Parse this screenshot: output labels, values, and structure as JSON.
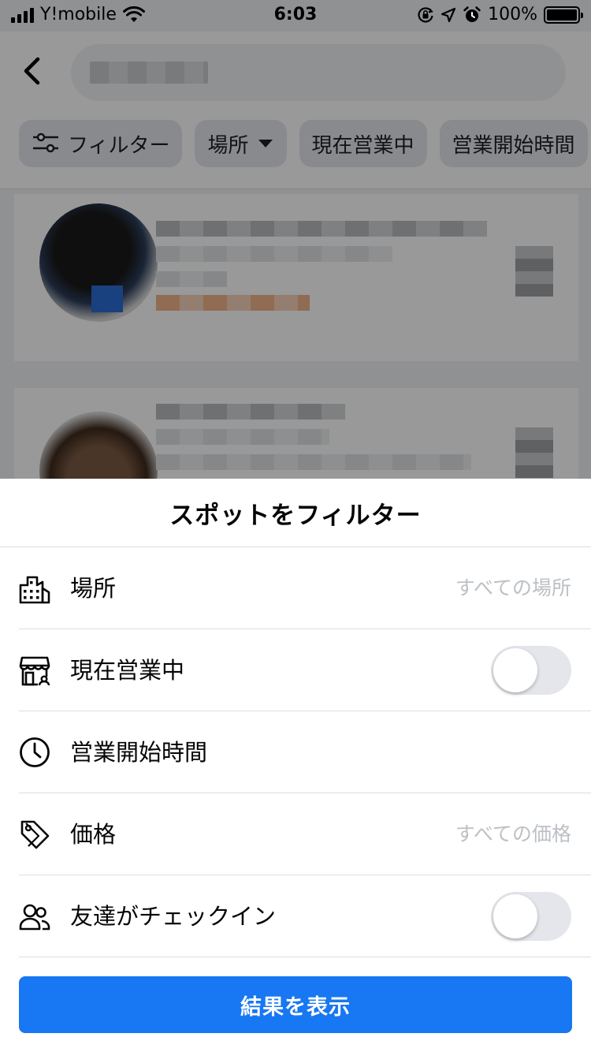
{
  "status_bar": {
    "carrier": "Y!mobile",
    "time": "6:03",
    "battery": "100%",
    "icons": [
      "signal-icon",
      "wifi-icon",
      "orientation-lock-icon",
      "location-icon",
      "alarm-icon",
      "battery-icon"
    ]
  },
  "background": {
    "filter_chips": [
      {
        "label": "フィルター",
        "icon": "sliders-icon"
      },
      {
        "label": "場所",
        "icon": "caret-down-icon"
      },
      {
        "label": "現在営業中"
      },
      {
        "label": "営業開始時間"
      }
    ]
  },
  "sheet": {
    "title": "スポットをフィルター",
    "rows": [
      {
        "label": "場所",
        "value": "すべての場所",
        "icon": "building-icon"
      },
      {
        "label": "現在営業中",
        "toggle_on": false,
        "icon": "storefront-icon"
      },
      {
        "label": "営業開始時間",
        "icon": "clock-icon"
      },
      {
        "label": "価格",
        "value": "すべての価格",
        "icon": "price-tag-icon"
      },
      {
        "label": "友達がチェックイン",
        "toggle_on": false,
        "icon": "friends-icon"
      }
    ],
    "primary_button": "結果を表示"
  },
  "colors": {
    "accent": "#1877f2",
    "toggle_off": "#e4e6eb",
    "secondary_text": "#bcc0c4",
    "divider": "#dadde1"
  }
}
